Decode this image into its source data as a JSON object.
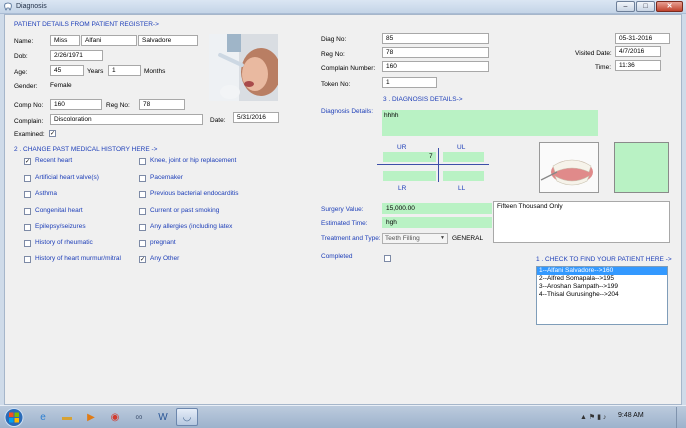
{
  "window": {
    "title": "Diagnosis",
    "min": "–",
    "max": "□",
    "close": "✕"
  },
  "patient": {
    "header": "PATIENT DETAILS FROM PATIENT REGISTER->",
    "name_label": "Name:",
    "title": "Miss",
    "first_name": "Alfani",
    "last_name": "Salvadore",
    "dob_label": "Dob:",
    "dob": "2/26/1971",
    "age_label": "Age:",
    "age_years": "45",
    "years_label": "Years",
    "age_months": "1",
    "months_label": "Months",
    "gender_label": "Gender:",
    "gender": "Female",
    "comp_no_label": "Comp No:",
    "comp_no": "160",
    "reg_no_label": "Reg No:",
    "reg_no": "78",
    "complain_label": "Complain:",
    "complain": "Discoloration",
    "date_label": "Date:",
    "date": "5/31/2016",
    "examined_label": "Examined:",
    "examined": true
  },
  "history": {
    "header": "2 . CHANGE PAST MEDICAL HISTORY HERE ->",
    "left": [
      {
        "label": "Recent heart",
        "checked": true
      },
      {
        "label": "Artificial heart valve(s)",
        "checked": false
      },
      {
        "label": "Asthma",
        "checked": false
      },
      {
        "label": "Congenital heart",
        "checked": false
      },
      {
        "label": "Epilepsy/seizures",
        "checked": false
      },
      {
        "label": "History of rheumatic",
        "checked": false
      },
      {
        "label": "History of heart murmur/mitral",
        "checked": false
      }
    ],
    "right": [
      {
        "label": "Knee, joint or hip replacement",
        "checked": false
      },
      {
        "label": "Pacemaker",
        "checked": false
      },
      {
        "label": "Previous bacterial endocarditis",
        "checked": false
      },
      {
        "label": "Current or past smoking",
        "checked": false
      },
      {
        "label": "Any allergies (including latex",
        "checked": false
      },
      {
        "label": "pregnant",
        "checked": false
      },
      {
        "label": "Any Other",
        "checked": true
      }
    ]
  },
  "diag": {
    "diag_no_label": "Diag No:",
    "diag_no": "85",
    "reg_no_label": "Reg No:",
    "reg_no": "78",
    "complain_number_label": "Complain Number:",
    "complain_number": "160",
    "token_no_label": "Token No:",
    "token_no": "1",
    "date": "05-31-2016",
    "visited_date_label": "Visited Date:",
    "visited_date": "4/7/2016",
    "time_label": "Time:",
    "time": "11:36",
    "details_header": "3 . DIAGNOSIS DETAILS->",
    "details_label": "Diagnosis Details:",
    "details_text": "hhhh",
    "quadrants": {
      "ur": "UR",
      "ul": "UL",
      "lr": "LR",
      "ll": "LL",
      "ur_value": "7"
    },
    "surgery_value_label": "Surgery Value:",
    "surgery_value": "15,000.00",
    "surgery_words": "Fifteen Thousand Only",
    "estimated_time_label": "Estimated Time:",
    "estimated_time": "hgh",
    "treatment_label": "Treatment and Type:",
    "treatment_value": "Teeth Filling",
    "treatment_type": "GENERAL",
    "completed_label": "Completed",
    "completed": false
  },
  "finder": {
    "header": "1 . CHECK TO FIND YOUR PATIENT HERE ->",
    "items": [
      "1--Alfani Salvadore-->160",
      "2--Alfred Somapala-->195",
      "3--Aroshan Sampath-->199",
      "4--Thisal Gurusinghe-->204"
    ],
    "selected_index": 0
  },
  "taskbar": {
    "clock": "9:48 AM",
    "apps": [
      "ie-icon",
      "folder-icon",
      "media-icon",
      "chrome-icon",
      "infinity-icon",
      "word-icon",
      "tooth-app-icon"
    ]
  },
  "colors": {
    "field_green": "#b9f2c4",
    "label_blue": "#1d3eb8",
    "selection": "#3399ff"
  }
}
